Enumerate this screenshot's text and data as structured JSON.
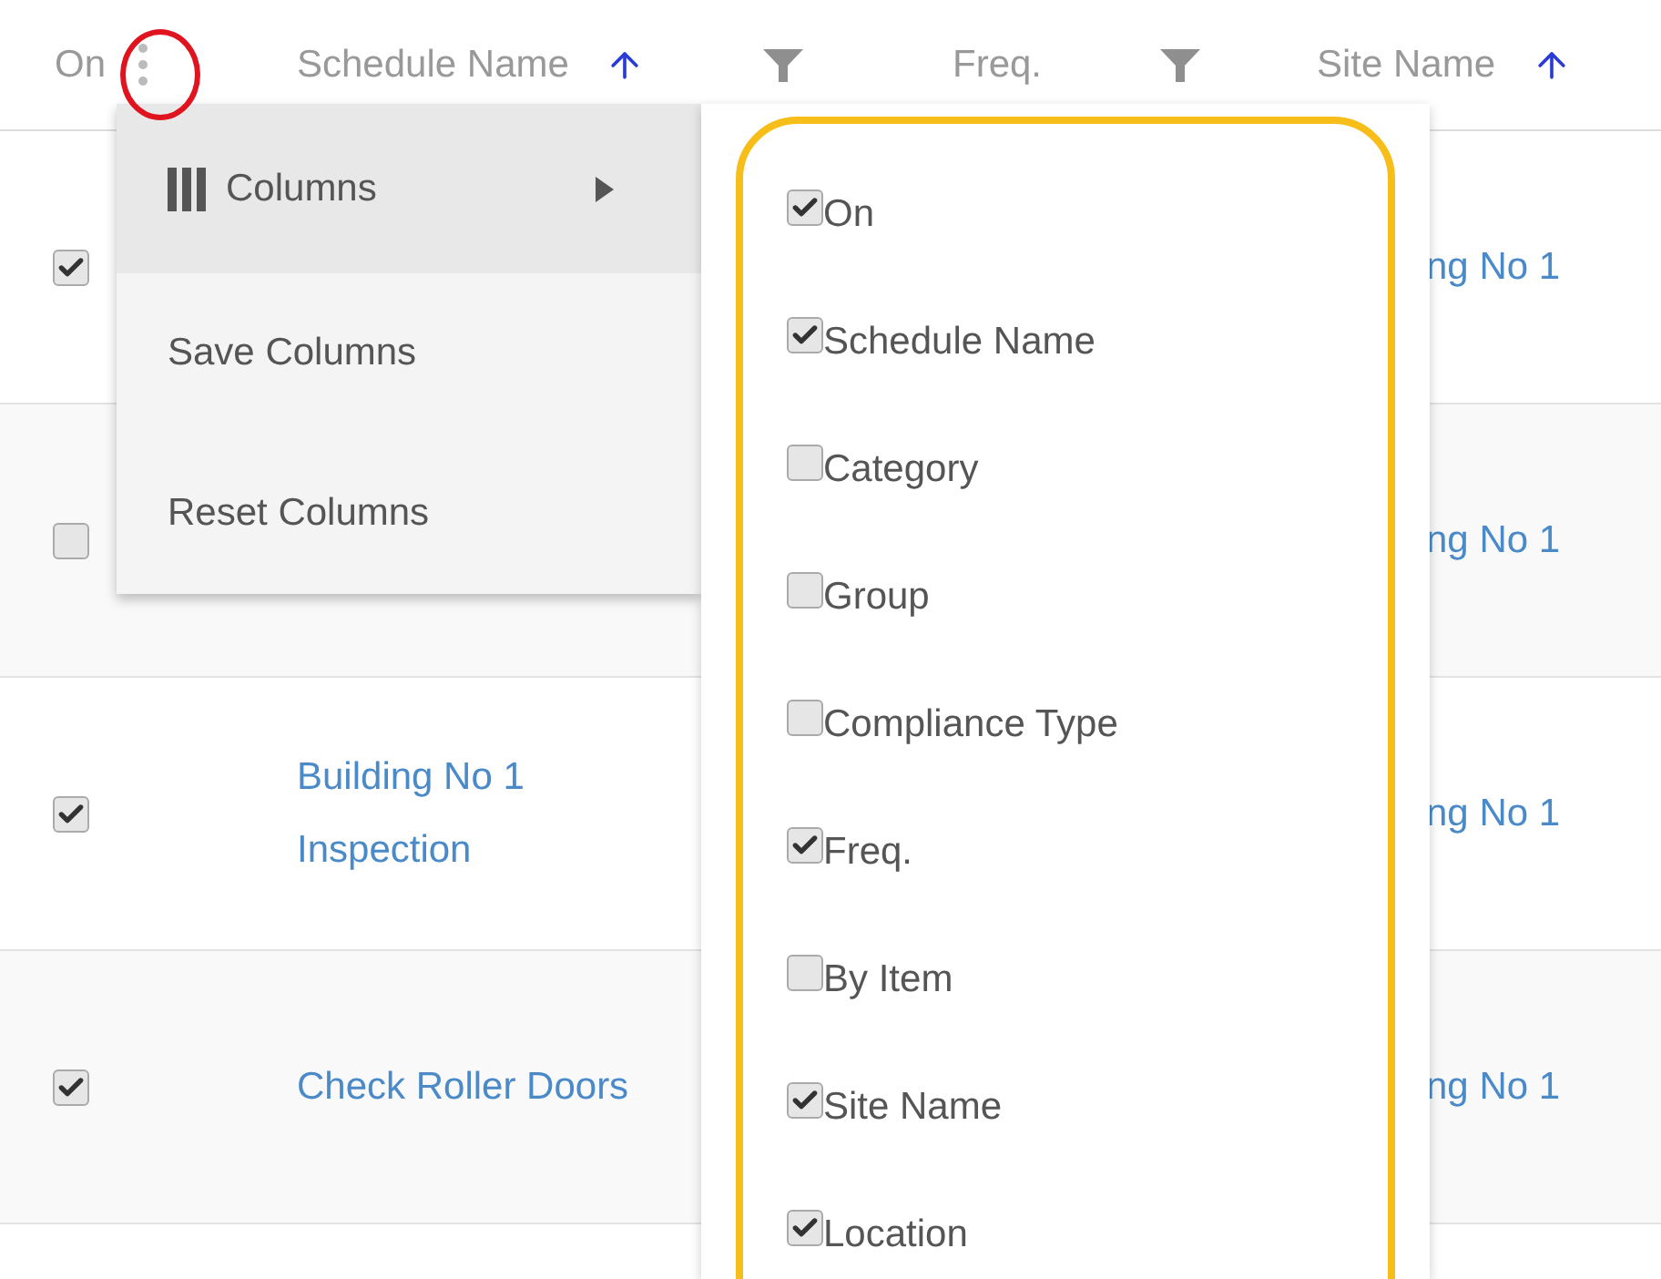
{
  "header": [
    {
      "label": "On",
      "kind": "menu"
    },
    {
      "label": "Schedule Name",
      "kind": "sort-filter"
    },
    {
      "label": "Freq.",
      "kind": "filter"
    },
    {
      "label": "Site Name",
      "kind": "sort"
    }
  ],
  "rows": [
    {
      "on": true,
      "name": "",
      "site": "ng No 1"
    },
    {
      "on": false,
      "name": "",
      "site": "ng No 1"
    },
    {
      "on": true,
      "name": "Building No 1 Inspection",
      "site": "ng No 1"
    },
    {
      "on": true,
      "name": "Check Roller Doors",
      "site": "ng No 1"
    }
  ],
  "menu": [
    {
      "label": "Columns",
      "kind": "submenu",
      "selected": true
    },
    {
      "label": "Save Columns",
      "kind": "action",
      "selected": false
    },
    {
      "label": "Reset Columns",
      "kind": "action",
      "selected": false
    }
  ],
  "columns_menu": [
    {
      "label": "On",
      "checked": true
    },
    {
      "label": "Schedule Name",
      "checked": true
    },
    {
      "label": "Category",
      "checked": false
    },
    {
      "label": "Group",
      "checked": false
    },
    {
      "label": "Compliance Type",
      "checked": false
    },
    {
      "label": "Freq.",
      "checked": true
    },
    {
      "label": "By Item",
      "checked": false
    },
    {
      "label": "Site Name",
      "checked": true
    },
    {
      "label": "Location",
      "checked": true
    }
  ]
}
